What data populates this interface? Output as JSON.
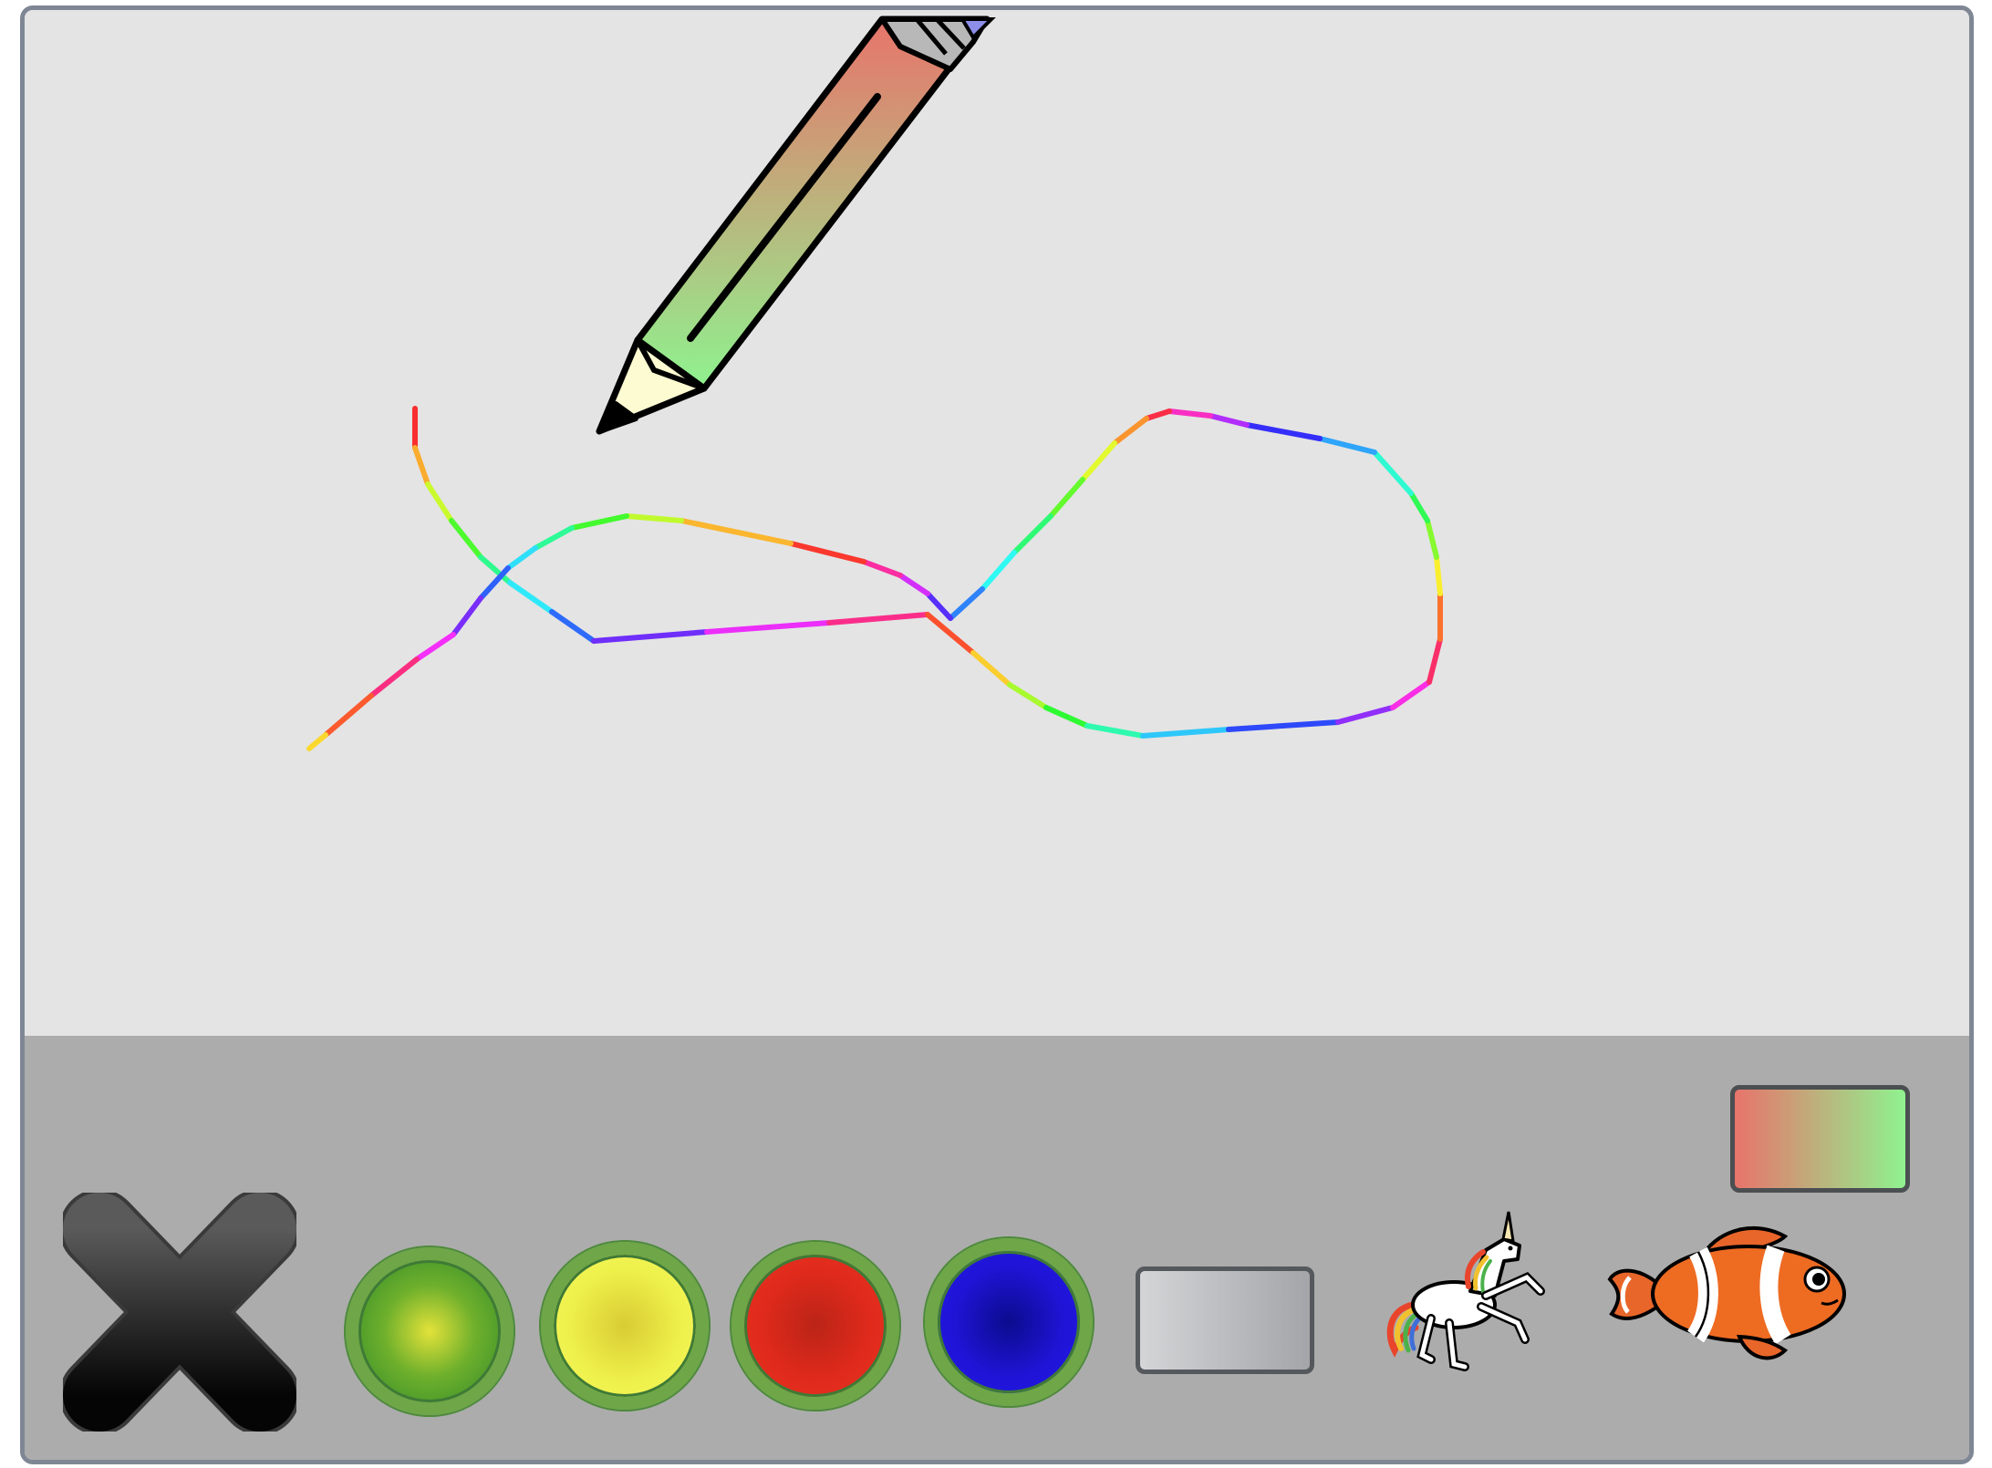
{
  "colors": {
    "canvas_background": "#e4e4e4",
    "toolbar_background": "#acacac",
    "frame_border": "#7f8795",
    "pencil_gradient_start": "#e8746b",
    "pencil_gradient_end": "#8ff28f",
    "brush_gradient_start": "#e8746b",
    "brush_gradient_end": "#8ff28f"
  },
  "canvas": {
    "stroke_style": "rainbow",
    "cursor_tool": "pencil-icon"
  },
  "toolbar": {
    "tools": [
      {
        "name": "clear-canvas",
        "icon": "x-icon"
      },
      {
        "name": "color-green",
        "color": "#5fa92c"
      },
      {
        "name": "color-yellow",
        "color": "#eef04a"
      },
      {
        "name": "color-red",
        "color": "#e02a1c"
      },
      {
        "name": "color-blue",
        "color": "#1f14d6"
      },
      {
        "name": "eraser",
        "icon": "eraser-icon"
      },
      {
        "name": "stamp-unicorn",
        "icon": "unicorn-icon"
      },
      {
        "name": "stamp-clownfish",
        "icon": "clownfish-icon"
      }
    ],
    "current_brush": {
      "style": "gradient",
      "from": "#e8746b",
      "to": "#8ff28f"
    }
  }
}
